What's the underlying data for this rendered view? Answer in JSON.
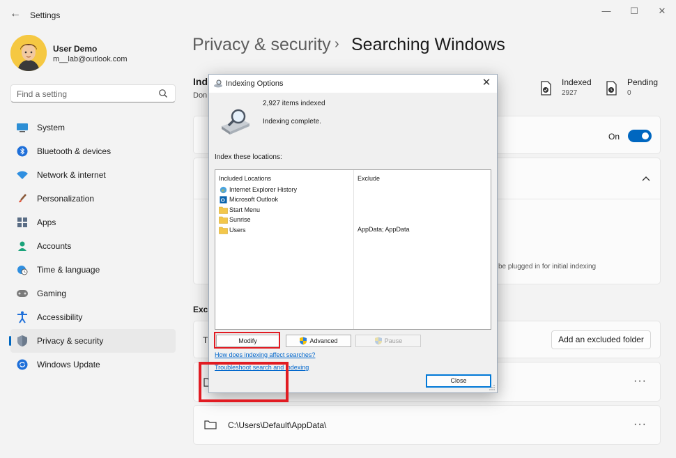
{
  "window": {
    "title": "Settings"
  },
  "user": {
    "name": "User Demo",
    "email": "m__lab@outlook.com"
  },
  "search": {
    "placeholder": "Find a setting"
  },
  "sidebar": {
    "items": [
      {
        "label": "System",
        "icon": "monitor-icon"
      },
      {
        "label": "Bluetooth & devices",
        "icon": "bluetooth-icon"
      },
      {
        "label": "Network & internet",
        "icon": "wifi-icon"
      },
      {
        "label": "Personalization",
        "icon": "brush-icon"
      },
      {
        "label": "Apps",
        "icon": "apps-icon"
      },
      {
        "label": "Accounts",
        "icon": "person-icon"
      },
      {
        "label": "Time & language",
        "icon": "globe-clock-icon"
      },
      {
        "label": "Gaming",
        "icon": "gamepad-icon"
      },
      {
        "label": "Accessibility",
        "icon": "accessibility-icon"
      },
      {
        "label": "Privacy & security",
        "icon": "shield-icon",
        "active": true
      },
      {
        "label": "Windows Update",
        "icon": "update-icon"
      }
    ]
  },
  "header": {
    "parent": "Privacy & security",
    "separator": "›",
    "current": "Searching Windows"
  },
  "main": {
    "section1_title": "Ind",
    "section1_sub": "Don",
    "indexed": {
      "label": "Indexed",
      "value": "2927"
    },
    "pending": {
      "label": "Pending",
      "value": "0"
    },
    "toggle_label": "On",
    "plugged_text": "be plugged in for initial indexing",
    "section2_title": "Excl",
    "row_char": "T",
    "add_folder_label": "Add an excluded folder",
    "excluded_path": "C:\\Users\\Default\\AppData\\",
    "more_label": "···"
  },
  "dialog": {
    "title": "Indexing Options",
    "close_glyph": "✕",
    "items_count": "2,927 items indexed",
    "status": "Indexing complete.",
    "index_label": "Index these locations:",
    "col_included": "Included Locations",
    "col_exclude": "Exclude",
    "locations": [
      {
        "name": "Internet Explorer History",
        "icon": "ie-history-icon",
        "exclude": ""
      },
      {
        "name": "Microsoft Outlook",
        "icon": "outlook-icon",
        "exclude": ""
      },
      {
        "name": "Start Menu",
        "icon": "folder-icon",
        "exclude": ""
      },
      {
        "name": "Sunrise",
        "icon": "folder-icon",
        "exclude": ""
      },
      {
        "name": "Users",
        "icon": "folder-icon",
        "exclude": "AppData; AppData"
      }
    ],
    "modify_label": "Modify",
    "advanced_label": "Advanced",
    "pause_label": "Pause",
    "link_help": "How does indexing affect searches?",
    "link_troubleshoot": "Troubleshoot search and indexing",
    "close_label": "Close"
  },
  "colors": {
    "accent": "#0067c0",
    "highlight": "#e11b22"
  }
}
